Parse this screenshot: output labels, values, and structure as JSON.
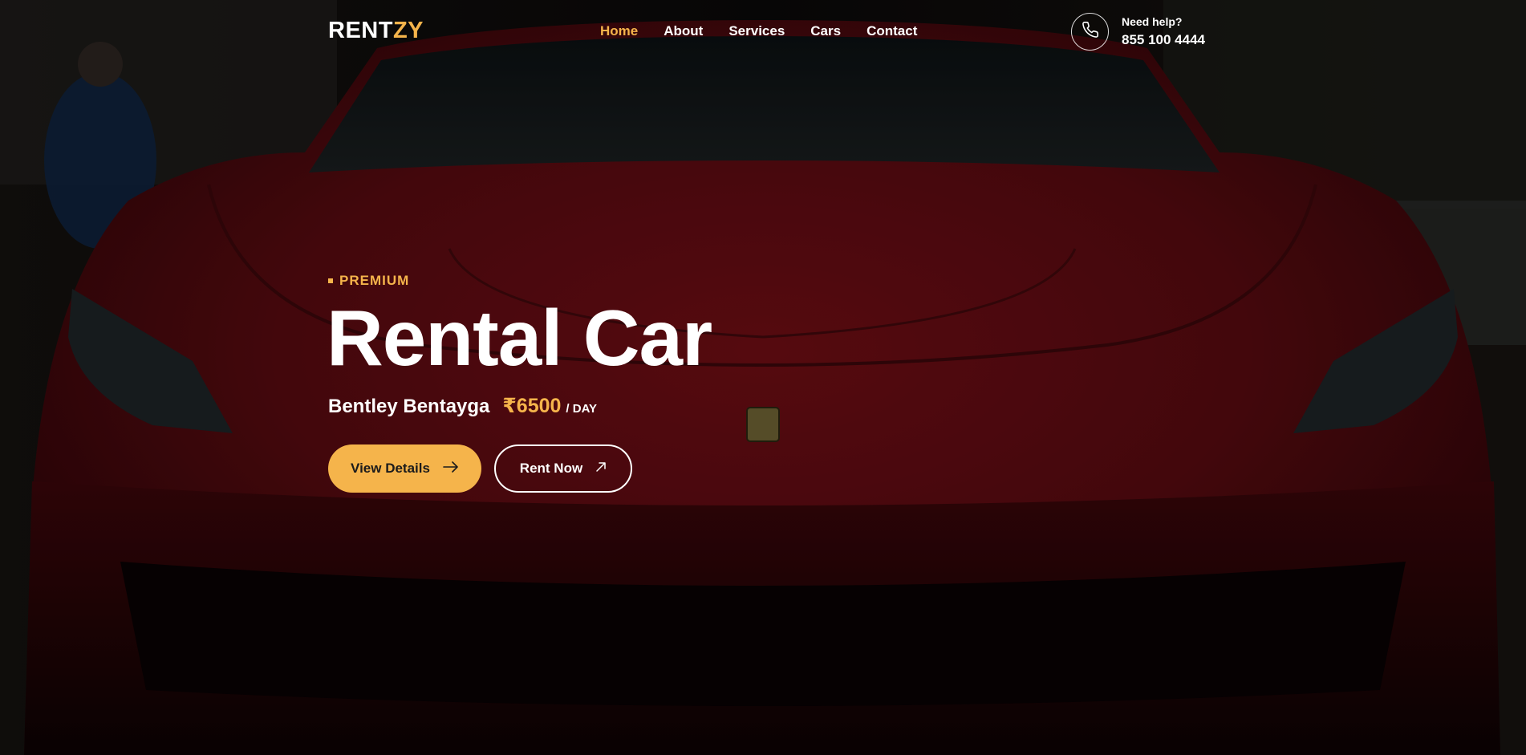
{
  "brand": {
    "logo_main": "RENT",
    "logo_accent": "ZY"
  },
  "nav": {
    "items": [
      {
        "label": "Home",
        "active": true
      },
      {
        "label": "About",
        "active": false
      },
      {
        "label": "Services",
        "active": false
      },
      {
        "label": "Cars",
        "active": false
      },
      {
        "label": "Contact",
        "active": false
      }
    ]
  },
  "help": {
    "label": "Need help?",
    "phone": "855 100 4444",
    "icon": "phone-icon"
  },
  "hero": {
    "tagline": "PREMIUM",
    "title": "Rental Car",
    "car_name": "Bentley Bentayga",
    "price": "₹6500",
    "price_unit": "/ DAY",
    "background": "red sports car front view"
  },
  "buttons": {
    "view_details": "View Details",
    "rent_now": "Rent Now",
    "view_details_icon": "arrow-right-icon",
    "rent_now_icon": "arrow-up-right-icon"
  },
  "colors": {
    "accent": "#f5b44b",
    "car_red": "#6e0d14",
    "background": "#080506"
  }
}
